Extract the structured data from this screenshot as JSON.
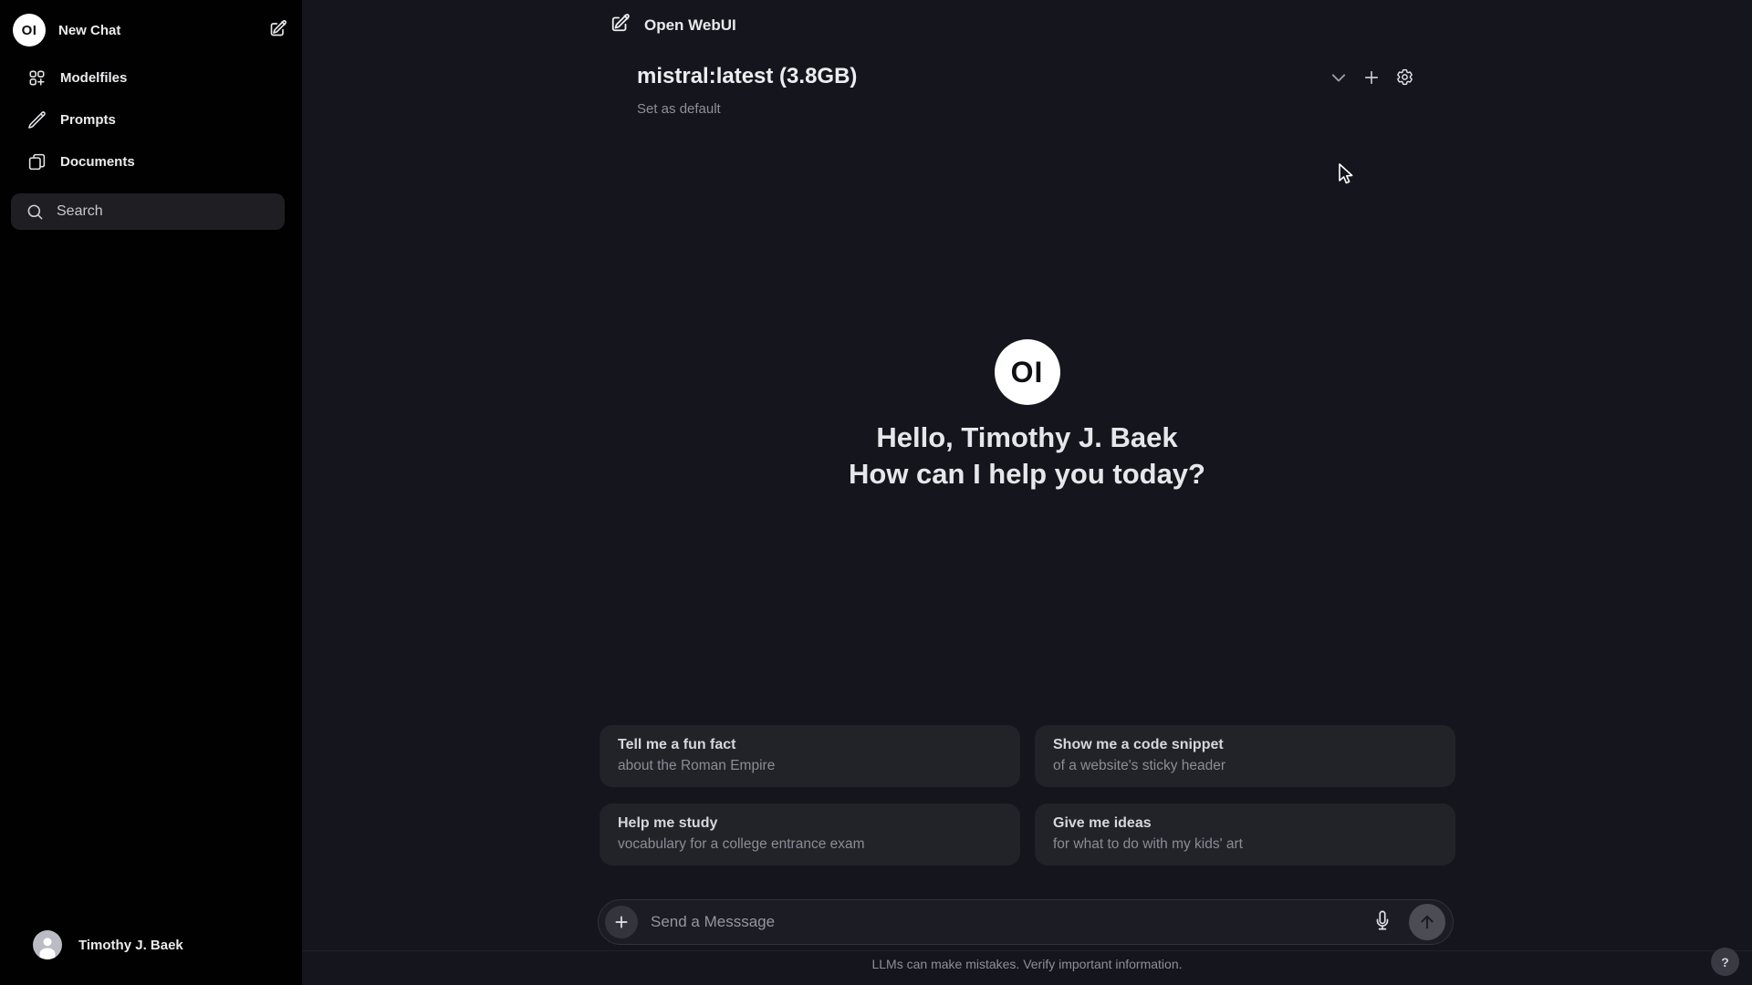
{
  "app": {
    "title": "Open WebUI",
    "logo_text": "OI"
  },
  "sidebar": {
    "new_chat_label": "New Chat",
    "items": [
      {
        "label": "Modelfiles",
        "icon": "squares-plus-icon"
      },
      {
        "label": "Prompts",
        "icon": "pencil-icon"
      },
      {
        "label": "Documents",
        "icon": "documents-icon"
      }
    ],
    "search_label": "Search",
    "user_name": "Timothy J. Baek"
  },
  "model_selector": {
    "model_label": "mistral:latest (3.8GB)",
    "set_default_label": "Set as default"
  },
  "hero": {
    "logo_text": "OI",
    "greeting_line1": "Hello, Timothy J. Baek",
    "greeting_line2": "How can I help you today?"
  },
  "suggestions": [
    {
      "title": "Tell me a fun fact",
      "subtitle": "about the Roman Empire"
    },
    {
      "title": "Show me a code snippet",
      "subtitle": "of a website's sticky header"
    },
    {
      "title": "Help me study",
      "subtitle": "vocabulary for a college entrance exam"
    },
    {
      "title": "Give me ideas",
      "subtitle": "for what to do with my kids' art"
    }
  ],
  "composer": {
    "placeholder": "Send a Messsage",
    "disclaimer": "LLMs can make mistakes. Verify important information."
  },
  "help": {
    "label": "?"
  },
  "colors": {
    "sidebar_bg": "#000000",
    "main_bg": "#15151d",
    "card_bg": "#222229",
    "logo_bg": "#ffffff",
    "muted_text": "#8f8f99"
  }
}
